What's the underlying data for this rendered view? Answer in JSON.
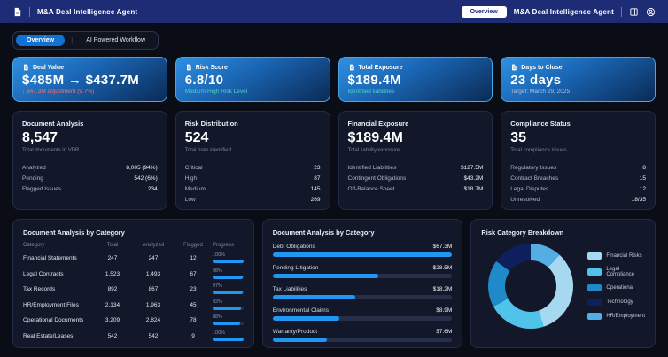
{
  "header": {
    "left_title": "M&A Deal Intelligence Agent",
    "overview_button": "Overview",
    "right_title": "M&A Deal Intelligence Agent"
  },
  "tabs": [
    {
      "label": "Overview",
      "active": true
    },
    {
      "label": "AI Powered Workflow",
      "active": false
    }
  ],
  "kpi_cards": [
    {
      "label": "Deal Value",
      "value": "$485M → $437.7M",
      "subtitle": "↓ $47.3M adjustment (9.7%)",
      "subtitle_color": "#f87171"
    },
    {
      "label": "Risk Score",
      "value": "6.8/10",
      "subtitle": "Medium-High Risk Level",
      "subtitle_color": "#4fd1c5"
    },
    {
      "label": "Total Exposure",
      "value": "$189.4M",
      "subtitle": "Identified liabilities",
      "subtitle_color": "#4fd1c5"
    },
    {
      "label": "Days to Close",
      "value": "23 days",
      "subtitle": "Target: March 29, 2025",
      "subtitle_color": "#b9c2d8"
    }
  ],
  "stat_cards": [
    {
      "title": "Document Analysis",
      "value": "8,547",
      "caption": "Total documents in VDR",
      "rows": [
        {
          "label": "Analyzed",
          "value": "8,005 (94%)"
        },
        {
          "label": "Pending",
          "value": "542 (6%)"
        },
        {
          "label": "Flagged Issues",
          "value": "234"
        }
      ]
    },
    {
      "title": "Risk Distribution",
      "value": "524",
      "caption": "Total risks identified",
      "rows": [
        {
          "label": "Critical",
          "value": "23"
        },
        {
          "label": "High",
          "value": "87"
        },
        {
          "label": "Medium",
          "value": "145"
        },
        {
          "label": "Low",
          "value": "269"
        }
      ]
    },
    {
      "title": "Financial Exposure",
      "value": "$189.4M",
      "caption": "Total liability exposure",
      "rows": [
        {
          "label": "Identified Liabilities",
          "value": "$127.5M"
        },
        {
          "label": "Contingent Obligations",
          "value": "$43.2M"
        },
        {
          "label": "Off-Balance Sheet",
          "value": "$18.7M"
        }
      ]
    },
    {
      "title": "Compliance Status",
      "value": "35",
      "caption": "Total compliance issues",
      "rows": [
        {
          "label": "Regulatory Issues",
          "value": "8"
        },
        {
          "label": "Contract Breaches",
          "value": "15"
        },
        {
          "label": "Legal Disputes",
          "value": "12"
        },
        {
          "label": "Unresolved",
          "value": "18/35"
        }
      ]
    }
  ],
  "doc_table": {
    "title": "Document Analysis by Category",
    "columns": [
      "Category",
      "Total",
      "Analyzed",
      "Flagged",
      "Progress"
    ],
    "rows": [
      {
        "category": "Financial Statements",
        "total": "247",
        "analyzed": "247",
        "flagged": "12",
        "progress_label": "100%",
        "progress_pct": 100
      },
      {
        "category": "Legal Contracts",
        "total": "1,523",
        "analyzed": "1,493",
        "flagged": "67",
        "progress_label": "98%",
        "progress_pct": 98
      },
      {
        "category": "Tax Records",
        "total": "892",
        "analyzed": "867",
        "flagged": "23",
        "progress_label": "97%",
        "progress_pct": 97
      },
      {
        "category": "HR/Employment Files",
        "total": "2,134",
        "analyzed": "1,963",
        "flagged": "45",
        "progress_label": "92%",
        "progress_pct": 92
      },
      {
        "category": "Operational Documents",
        "total": "3,209",
        "analyzed": "2,824",
        "flagged": "78",
        "progress_label": "88%",
        "progress_pct": 88
      },
      {
        "category": "Real Estate/Leases",
        "total": "542",
        "analyzed": "542",
        "flagged": "9",
        "progress_label": "100%",
        "progress_pct": 100
      }
    ]
  },
  "exposure_chart": {
    "title": "Document Analysis by Category",
    "bars": [
      {
        "label": "Debt Obligations",
        "value": "$67.3M",
        "bar_pct": 100
      },
      {
        "label": "Pending Litigation",
        "value": "$28.5M",
        "bar_pct": 59
      },
      {
        "label": "Tax Liabilities",
        "value": "$18.2M",
        "bar_pct": 46
      },
      {
        "label": "Environmental Claims",
        "value": "$8.9M",
        "bar_pct": 37
      },
      {
        "label": "Warranty/Product",
        "value": "$7.6M",
        "bar_pct": 30
      }
    ]
  },
  "risk_donut": {
    "title": "Risk Category Breakdown",
    "segments": [
      {
        "label": "Financial Risks",
        "color": "#a6d9f0",
        "pct": 33
      },
      {
        "label": "Legal Compliance",
        "color": "#4fc3ea",
        "pct": 22
      },
      {
        "label": "Operational",
        "color": "#2089c8",
        "pct": 18
      },
      {
        "label": "Technology",
        "color": "#0e1f5e",
        "pct": 15
      },
      {
        "label": "HR/Employment",
        "color": "#54aee3",
        "pct": 12
      }
    ]
  },
  "chart_data": [
    {
      "type": "bar",
      "orientation": "horizontal",
      "title": "Document Analysis by Category",
      "categories": [
        "Debt Obligations",
        "Pending Litigation",
        "Tax Liabilities",
        "Environmental Claims",
        "Warranty/Product"
      ],
      "values": [
        67.3,
        28.5,
        18.2,
        8.9,
        7.6
      ],
      "value_labels": [
        "$67.3M",
        "$28.5M",
        "$18.2M",
        "$8.9M",
        "$7.6M"
      ],
      "xlabel": "",
      "ylabel": "",
      "unit": "$M",
      "grid": false,
      "legend_position": "none"
    },
    {
      "type": "pie",
      "title": "Risk Category Breakdown",
      "categories": [
        "Financial Risks",
        "Legal Compliance",
        "Operational",
        "Technology",
        "HR/Employment"
      ],
      "values": [
        33,
        22,
        18,
        15,
        12
      ],
      "colors": [
        "#a6d9f0",
        "#4fc3ea",
        "#2089c8",
        "#0e1f5e",
        "#54aee3"
      ],
      "legend_position": "right",
      "donut": true
    },
    {
      "type": "table",
      "title": "Document Analysis by Category",
      "columns": [
        "Category",
        "Total",
        "Analyzed",
        "Flagged",
        "Progress"
      ],
      "rows": [
        [
          "Financial Statements",
          247,
          247,
          12,
          "100%"
        ],
        [
          "Legal Contracts",
          1523,
          1493,
          67,
          "98%"
        ],
        [
          "Tax Records",
          892,
          867,
          23,
          "97%"
        ],
        [
          "HR/Employment Files",
          2134,
          1963,
          45,
          "92%"
        ],
        [
          "Operational Documents",
          3209,
          2824,
          78,
          "88%"
        ],
        [
          "Real Estate/Leases",
          542,
          542,
          9,
          "100%"
        ]
      ]
    }
  ],
  "colors": {
    "accent_blue": "#2196f3",
    "header_bg": "#1d2c74",
    "kpi_border": "#4ba4e2",
    "card_bg": "#121829"
  }
}
